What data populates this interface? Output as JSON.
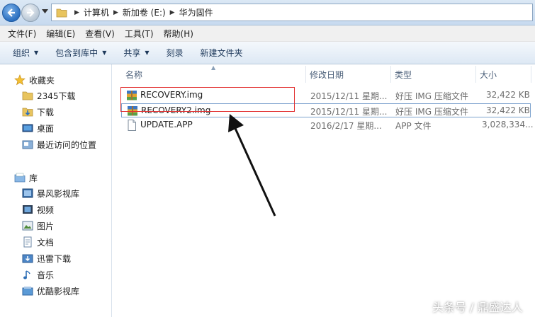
{
  "address_bar": {
    "crumbs": [
      "计算机",
      "新加卷 (E:)",
      "华为固件"
    ]
  },
  "menu": [
    "文件(F)",
    "编辑(E)",
    "查看(V)",
    "工具(T)",
    "帮助(H)"
  ],
  "toolbar": {
    "organize": "组织",
    "include_in_library": "包含到库中",
    "share": "共享",
    "burn": "刻录",
    "new_folder": "新建文件夹"
  },
  "nav": {
    "favorites": "收藏夹",
    "favorite_items": [
      "2345下载",
      "下载",
      "桌面",
      "最近访问的位置"
    ],
    "libraries": "库",
    "library_items": [
      "暴风影视库",
      "视频",
      "图片",
      "文档",
      "迅雷下载",
      "音乐",
      "优酷影视库"
    ]
  },
  "columns": {
    "name": "名称",
    "date": "修改日期",
    "type": "类型",
    "size": "大小"
  },
  "files": [
    {
      "name": "RECOVERY.img",
      "date": "2015/12/11 星期...",
      "type": "好压 IMG 压缩文件",
      "size": "32,422 KB",
      "icon": "archive-icon"
    },
    {
      "name": "RECOVERY2.img",
      "date": "2015/12/11 星期...",
      "type": "好压 IMG 压缩文件",
      "size": "32,422 KB",
      "icon": "archive-icon"
    },
    {
      "name": "UPDATE.APP",
      "date": "2016/2/17 星期...",
      "type": "APP 文件",
      "size": "3,028,334...",
      "icon": "file-icon"
    }
  ],
  "colors": {
    "annotation_red": "#e23030",
    "selection_border": "#7da2ce",
    "header_text": "#4c607a"
  },
  "watermark": "头条号 / 鼎盛达人"
}
